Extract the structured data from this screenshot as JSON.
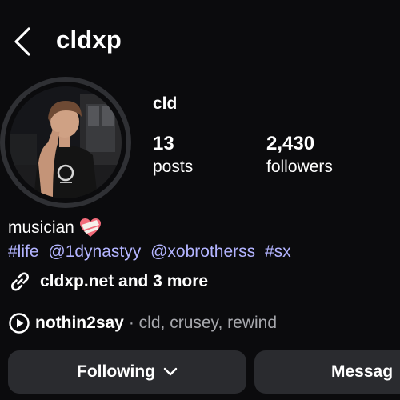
{
  "header": {
    "back_icon": "chevron-left-icon",
    "username": "cldxp"
  },
  "profile": {
    "display_name": "cld",
    "stats": [
      {
        "count": "13",
        "label": "posts"
      },
      {
        "count": "2,430",
        "label": "followers"
      }
    ]
  },
  "bio": {
    "line1": "musician",
    "emoji_icon": "bandaged-heart-icon",
    "tags": [
      "#life",
      "@1dynastyy",
      "@xobrotherss",
      "#sx"
    ],
    "tag_color": "#b3b4ff"
  },
  "link": {
    "icon": "link-icon",
    "text": "cldxp.net and 3 more"
  },
  "music": {
    "icon": "play-circle-icon",
    "title": "nothin2say",
    "meta": "· cld, crusey, rewind"
  },
  "buttons": {
    "following_label": "Following",
    "following_icon": "chevron-down-icon",
    "message_label": "Messag"
  },
  "colors": {
    "background": "#0b0b0d",
    "button_bg": "#2a2b2f",
    "muted_text": "#a7a8ad"
  }
}
